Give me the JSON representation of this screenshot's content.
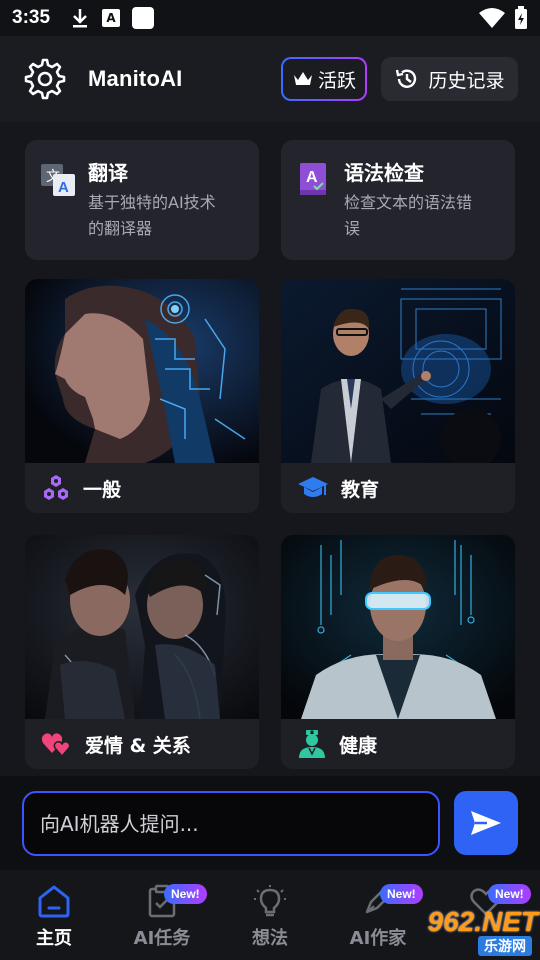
{
  "status_bar": {
    "time": "3:35",
    "icons_left": [
      "download-icon",
      "a-letter-icon",
      "square-icon"
    ],
    "icons_right": [
      "wifi-icon",
      "battery-icon"
    ]
  },
  "header": {
    "title": "ManitoAI",
    "active_label": "活跃",
    "history_label": "历史记录"
  },
  "features": [
    {
      "title": "翻译",
      "desc_line1": "基于独特的AI技术",
      "desc_line2": "的翻译器",
      "icon": "translate-icon"
    },
    {
      "title": "语法检查",
      "desc_line1": "检查文本的语法错",
      "desc_line2": "误",
      "icon": "grammar-icon"
    }
  ],
  "categories": [
    {
      "label": "一般",
      "icon": "hexagons-icon",
      "icon_color": "#a56bf5"
    },
    {
      "label": "教育",
      "icon": "graduation-cap-icon",
      "icon_color": "#2f7bf0"
    },
    {
      "label": "爱情 & 关系",
      "icon": "hearts-icon",
      "icon_color": "#f0457a"
    },
    {
      "label": "健康",
      "icon": "doctor-icon",
      "icon_color": "#2fc7a0"
    }
  ],
  "prompt": {
    "placeholder": "向AI机器人提问..."
  },
  "nav": {
    "items": [
      {
        "label": "主页",
        "icon": "home-icon",
        "active": true,
        "badge": ""
      },
      {
        "label": "AI任务",
        "icon": "clipboard-icon",
        "active": false,
        "badge": "New!"
      },
      {
        "label": "想法",
        "icon": "lightbulb-icon",
        "active": false,
        "badge": ""
      },
      {
        "label": "AI作家",
        "icon": "pen-icon",
        "active": false,
        "badge": "New!"
      },
      {
        "label": "",
        "icon": "heart-icon",
        "active": false,
        "badge": "New!"
      }
    ]
  },
  "watermark": {
    "main": "962.NET",
    "sub": "乐游网"
  },
  "colors": {
    "accent": "#2e63f5",
    "gradient_start": "#3b6cff",
    "gradient_end": "#b03cff",
    "background": "#16171c"
  }
}
